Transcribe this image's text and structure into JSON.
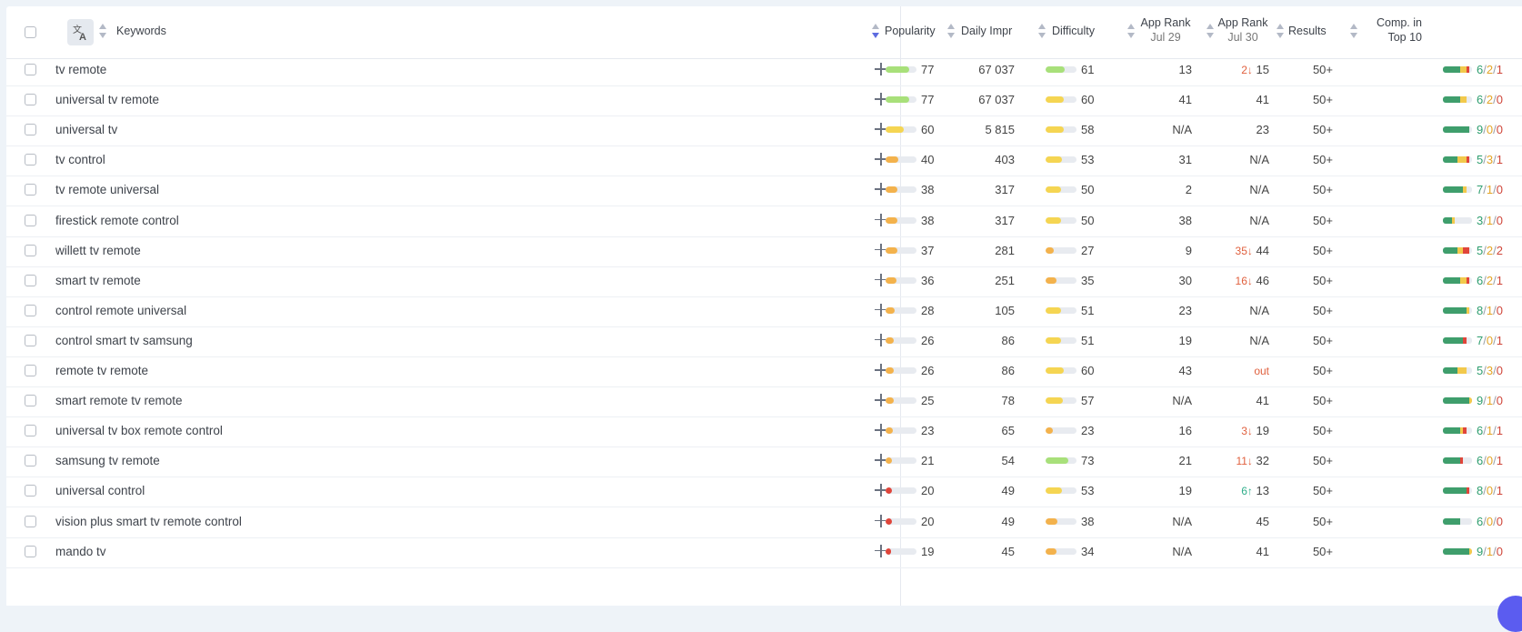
{
  "header": {
    "keywords": "Keywords",
    "popularity": "Popularity",
    "daily_impr": "Daily Impr",
    "difficulty": "Difficulty",
    "app_rank_1": {
      "line1": "App Rank",
      "line2": "Jul 29"
    },
    "app_rank_2": {
      "line1": "App Rank",
      "line2": "Jul 30"
    },
    "results": "Results",
    "comp": {
      "line1": "Comp. in",
      "line2": "Top 10"
    }
  },
  "colors": {
    "green": "#a8e07a",
    "yellow": "#f5d552",
    "orange": "#f3b24c",
    "red": "#e0453a",
    "comp_green": "#3f9e6c",
    "comp_yellow": "#f2c94c",
    "comp_red": "#e0453a"
  },
  "rows": [
    {
      "keyword": "tv remote",
      "popularity": "77",
      "pop_color": "green",
      "daily_impr": "67 037",
      "difficulty": "61",
      "diff_color": "green",
      "rank_jul29": "13",
      "rank_change": "2↓",
      "change_dir": "down",
      "rank_jul30": "15",
      "results": "50+",
      "comp_g": "6",
      "comp_y": "2",
      "comp_r": "1"
    },
    {
      "keyword": "universal tv remote",
      "popularity": "77",
      "pop_color": "green",
      "daily_impr": "67 037",
      "difficulty": "60",
      "diff_color": "yellow",
      "rank_jul29": "41",
      "rank_change": "",
      "change_dir": "",
      "rank_jul30": "41",
      "results": "50+",
      "comp_g": "6",
      "comp_y": "2",
      "comp_r": "0"
    },
    {
      "keyword": "universal tv",
      "popularity": "60",
      "pop_color": "yellow",
      "daily_impr": "5 815",
      "difficulty": "58",
      "diff_color": "yellow",
      "rank_jul29": "N/A",
      "rank_change": "",
      "change_dir": "",
      "rank_jul30": "23",
      "results": "50+",
      "comp_g": "9",
      "comp_y": "0",
      "comp_r": "0"
    },
    {
      "keyword": "tv control",
      "popularity": "40",
      "pop_color": "orange",
      "daily_impr": "403",
      "difficulty": "53",
      "diff_color": "yellow",
      "rank_jul29": "31",
      "rank_change": "",
      "change_dir": "",
      "rank_jul30": "N/A",
      "results": "50+",
      "comp_g": "5",
      "comp_y": "3",
      "comp_r": "1"
    },
    {
      "keyword": "tv remote universal",
      "popularity": "38",
      "pop_color": "orange",
      "daily_impr": "317",
      "difficulty": "50",
      "diff_color": "yellow",
      "rank_jul29": "2",
      "rank_change": "",
      "change_dir": "",
      "rank_jul30": "N/A",
      "results": "50+",
      "comp_g": "7",
      "comp_y": "1",
      "comp_r": "0"
    },
    {
      "keyword": "firestick remote control",
      "popularity": "38",
      "pop_color": "orange",
      "daily_impr": "317",
      "difficulty": "50",
      "diff_color": "yellow",
      "rank_jul29": "38",
      "rank_change": "",
      "change_dir": "",
      "rank_jul30": "N/A",
      "results": "50+",
      "comp_g": "3",
      "comp_y": "1",
      "comp_r": "0"
    },
    {
      "keyword": "willett tv remote",
      "popularity": "37",
      "pop_color": "orange",
      "daily_impr": "281",
      "difficulty": "27",
      "diff_color": "orange",
      "rank_jul29": "9",
      "rank_change": "35↓",
      "change_dir": "down",
      "rank_jul30": "44",
      "results": "50+",
      "comp_g": "5",
      "comp_y": "2",
      "comp_r": "2"
    },
    {
      "keyword": "smart tv remote",
      "popularity": "36",
      "pop_color": "orange",
      "daily_impr": "251",
      "difficulty": "35",
      "diff_color": "orange",
      "rank_jul29": "30",
      "rank_change": "16↓",
      "change_dir": "down",
      "rank_jul30": "46",
      "results": "50+",
      "comp_g": "6",
      "comp_y": "2",
      "comp_r": "1"
    },
    {
      "keyword": "control remote universal",
      "popularity": "28",
      "pop_color": "orange",
      "daily_impr": "105",
      "difficulty": "51",
      "diff_color": "yellow",
      "rank_jul29": "23",
      "rank_change": "",
      "change_dir": "",
      "rank_jul30": "N/A",
      "results": "50+",
      "comp_g": "8",
      "comp_y": "1",
      "comp_r": "0"
    },
    {
      "keyword": "control smart tv samsung",
      "popularity": "26",
      "pop_color": "orange",
      "daily_impr": "86",
      "difficulty": "51",
      "diff_color": "yellow",
      "rank_jul29": "19",
      "rank_change": "",
      "change_dir": "",
      "rank_jul30": "N/A",
      "results": "50+",
      "comp_g": "7",
      "comp_y": "0",
      "comp_r": "1"
    },
    {
      "keyword": "remote tv remote",
      "popularity": "26",
      "pop_color": "orange",
      "daily_impr": "86",
      "difficulty": "60",
      "diff_color": "yellow",
      "rank_jul29": "43",
      "rank_change": "",
      "change_dir": "",
      "rank_jul30": "out",
      "results": "50+",
      "comp_g": "5",
      "comp_y": "3",
      "comp_r": "0"
    },
    {
      "keyword": "smart remote tv remote",
      "popularity": "25",
      "pop_color": "orange",
      "daily_impr": "78",
      "difficulty": "57",
      "diff_color": "yellow",
      "rank_jul29": "N/A",
      "rank_change": "",
      "change_dir": "",
      "rank_jul30": "41",
      "results": "50+",
      "comp_g": "9",
      "comp_y": "1",
      "comp_r": "0"
    },
    {
      "keyword": "universal tv box remote control",
      "popularity": "23",
      "pop_color": "orange",
      "daily_impr": "65",
      "difficulty": "23",
      "diff_color": "orange",
      "rank_jul29": "16",
      "rank_change": "3↓",
      "change_dir": "down",
      "rank_jul30": "19",
      "results": "50+",
      "comp_g": "6",
      "comp_y": "1",
      "comp_r": "1"
    },
    {
      "keyword": "samsung tv remote",
      "popularity": "21",
      "pop_color": "orange",
      "daily_impr": "54",
      "difficulty": "73",
      "diff_color": "green",
      "rank_jul29": "21",
      "rank_change": "11↓",
      "change_dir": "down",
      "rank_jul30": "32",
      "results": "50+",
      "comp_g": "6",
      "comp_y": "0",
      "comp_r": "1"
    },
    {
      "keyword": "universal control",
      "popularity": "20",
      "pop_color": "red",
      "daily_impr": "49",
      "difficulty": "53",
      "diff_color": "yellow",
      "rank_jul29": "19",
      "rank_change": "6↑",
      "change_dir": "up",
      "rank_jul30": "13",
      "results": "50+",
      "comp_g": "8",
      "comp_y": "0",
      "comp_r": "1"
    },
    {
      "keyword": "vision plus smart tv remote control",
      "popularity": "20",
      "pop_color": "red",
      "daily_impr": "49",
      "difficulty": "38",
      "diff_color": "orange",
      "rank_jul29": "N/A",
      "rank_change": "",
      "change_dir": "",
      "rank_jul30": "45",
      "results": "50+",
      "comp_g": "6",
      "comp_y": "0",
      "comp_r": "0"
    },
    {
      "keyword": "mando tv",
      "popularity": "19",
      "pop_color": "red",
      "daily_impr": "45",
      "difficulty": "34",
      "diff_color": "orange",
      "rank_jul29": "N/A",
      "rank_change": "",
      "change_dir": "",
      "rank_jul30": "41",
      "results": "50+",
      "comp_g": "9",
      "comp_y": "1",
      "comp_r": "0"
    }
  ]
}
